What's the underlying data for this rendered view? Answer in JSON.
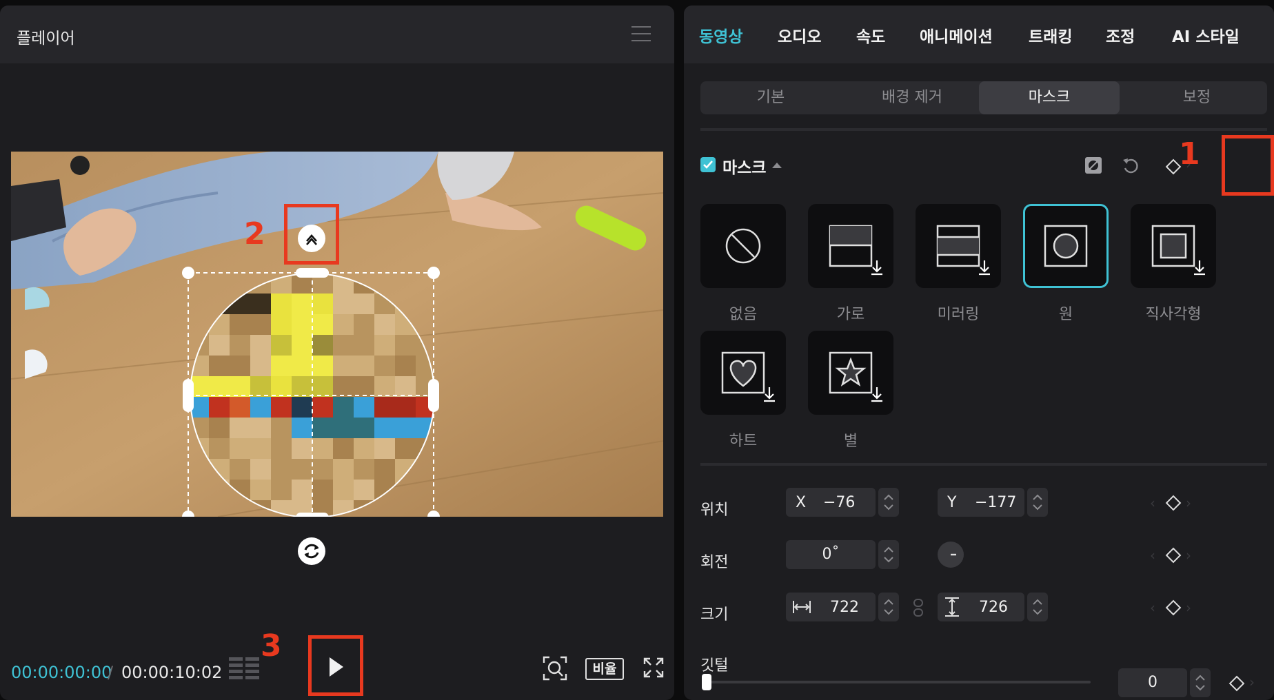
{
  "player": {
    "title": "플레이어",
    "current_time": "00:00:00:00",
    "separator": "/",
    "duration": "00:00:10:02",
    "ratio_label": "비율"
  },
  "annotations": [
    "1",
    "2",
    "3"
  ],
  "inspector": {
    "tabs": [
      {
        "label": "동영상",
        "active": true
      },
      {
        "label": "오디오"
      },
      {
        "label": "속도"
      },
      {
        "label": "애니메이션"
      },
      {
        "label": "트래킹"
      },
      {
        "label": "조정"
      },
      {
        "label": "AI 스타일"
      }
    ],
    "subtabs": [
      {
        "label": "기본"
      },
      {
        "label": "배경 제거"
      },
      {
        "label": "마스크",
        "active": true
      },
      {
        "label": "보정"
      }
    ],
    "mask_section": {
      "title": "마스크",
      "enabled": true,
      "shapes": [
        {
          "label": "없음",
          "icon": "none-icon"
        },
        {
          "label": "가로",
          "icon": "horizontal-mask-icon"
        },
        {
          "label": "미러링",
          "icon": "mirror-mask-icon"
        },
        {
          "label": "원",
          "icon": "circle-mask-icon",
          "selected": true
        },
        {
          "label": "직사각형",
          "icon": "rectangle-mask-icon"
        },
        {
          "label": "하트",
          "icon": "heart-mask-icon"
        },
        {
          "label": "별",
          "icon": "star-mask-icon"
        }
      ]
    },
    "position": {
      "label": "위치",
      "x_label": "X",
      "x": "−76",
      "y_label": "Y",
      "y": "−177"
    },
    "rotation": {
      "label": "회전",
      "value": "0˚"
    },
    "size": {
      "label": "크기",
      "width": "722",
      "height": "726"
    },
    "feather": {
      "label": "깃털",
      "value": "0"
    }
  },
  "colors": {
    "accent": "#3fc2d4",
    "annotation": "#e8391f"
  }
}
